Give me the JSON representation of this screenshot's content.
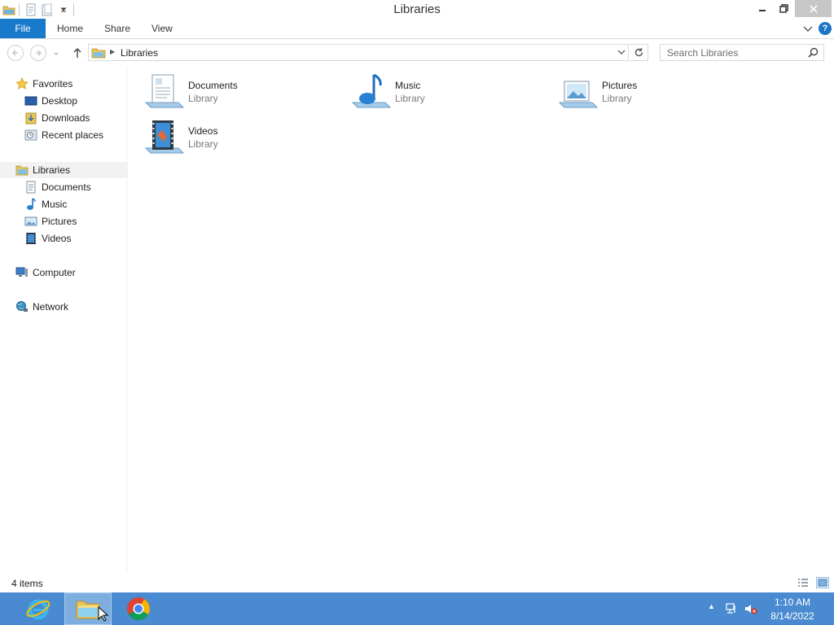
{
  "window": {
    "title": "Libraries"
  },
  "ribbon": {
    "tabs": [
      {
        "label": "File"
      },
      {
        "label": "Home"
      },
      {
        "label": "Share"
      },
      {
        "label": "View"
      }
    ],
    "help_label": "?"
  },
  "address_bar": {
    "path": [
      "Libraries"
    ]
  },
  "search": {
    "placeholder": "Search Libraries"
  },
  "nav_pane": {
    "favorites": {
      "label": "Favorites",
      "items": [
        {
          "label": "Desktop"
        },
        {
          "label": "Downloads"
        },
        {
          "label": "Recent places"
        }
      ]
    },
    "libraries": {
      "label": "Libraries",
      "selected": true,
      "items": [
        {
          "label": "Documents"
        },
        {
          "label": "Music"
        },
        {
          "label": "Pictures"
        },
        {
          "label": "Videos"
        }
      ]
    },
    "computer": {
      "label": "Computer"
    },
    "network": {
      "label": "Network"
    }
  },
  "content": {
    "items": [
      {
        "name": "Documents",
        "type": "Library",
        "icon": "documents-library-icon"
      },
      {
        "name": "Music",
        "type": "Library",
        "icon": "music-library-icon"
      },
      {
        "name": "Pictures",
        "type": "Library",
        "icon": "pictures-library-icon"
      },
      {
        "name": "Videos",
        "type": "Library",
        "icon": "videos-library-icon"
      }
    ]
  },
  "status_bar": {
    "item_count": "4 items"
  },
  "taskbar": {
    "apps": [
      {
        "name": "internet-explorer-icon"
      },
      {
        "name": "file-explorer-icon",
        "active": true
      },
      {
        "name": "chrome-icon"
      }
    ],
    "clock": {
      "time": "1:10 AM",
      "date": "8/14/2022"
    }
  },
  "colors": {
    "file_tab": "#1979ca",
    "taskbar": "#4a8ad0",
    "selection": "#f2f2f2"
  }
}
